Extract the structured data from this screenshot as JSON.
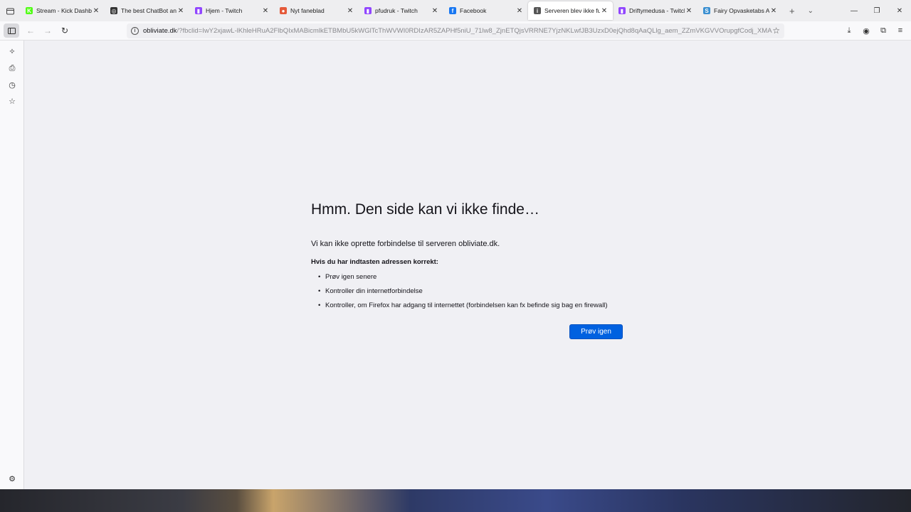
{
  "tabs": [
    {
      "title": "Stream - Kick Dashboard",
      "favicon_color": "#53fc18",
      "favicon_glyph": "K"
    },
    {
      "title": "The best ChatBot and Voice",
      "favicon_color": "#333333",
      "favicon_glyph": "◎"
    },
    {
      "title": "Hjem - Twitch",
      "favicon_color": "#9146ff",
      "favicon_glyph": "▮"
    },
    {
      "title": "Nyt faneblad",
      "favicon_color": "#e55a3a",
      "favicon_glyph": "●"
    },
    {
      "title": "pfudruk - Twitch",
      "favicon_color": "#9146ff",
      "favicon_glyph": "▮"
    },
    {
      "title": "Facebook",
      "favicon_color": "#1877f2",
      "favicon_glyph": "f"
    },
    {
      "title": "Serveren blev ikke fundet",
      "favicon_color": "#555555",
      "favicon_glyph": "i",
      "active": true
    },
    {
      "title": "Driftymedusa - Twitch",
      "favicon_color": "#9146ff",
      "favicon_glyph": "▮"
    },
    {
      "title": "Fairy Opvasketabs All-in-One",
      "favicon_color": "#3a8fd1",
      "favicon_glyph": "S"
    }
  ],
  "url": {
    "host": "obliviate.dk",
    "rest": "/?fbclid=IwY2xjawL-lKhleHRuA2FlbQIxMABicmlkETBMbU5kWGlTcThWVWI0RDIzAR5ZAPHf5niU_71lw8_ZjnETQjsVRRNE7YjzNKLwfJB3UzxD0ejQhd8qAaQLlg_aem_ZZmVKGVVOrupgfCodj_XMA"
  },
  "error": {
    "title": "Hmm. Den side kan vi ikke finde…",
    "description": "Vi kan ikke oprette forbindelse til serveren obliviate.dk.",
    "hint": "Hvis du har indtasten adressen korrekt:",
    "items": [
      "Prøv igen senere",
      "Kontroller din internetforbindelse",
      "Kontroller, om Firefox har adgang til internettet (forbindelsen kan fx befinde sig bag en firewall)"
    ],
    "retry_label": "Prøv igen"
  },
  "accent_color": "#0061e0"
}
